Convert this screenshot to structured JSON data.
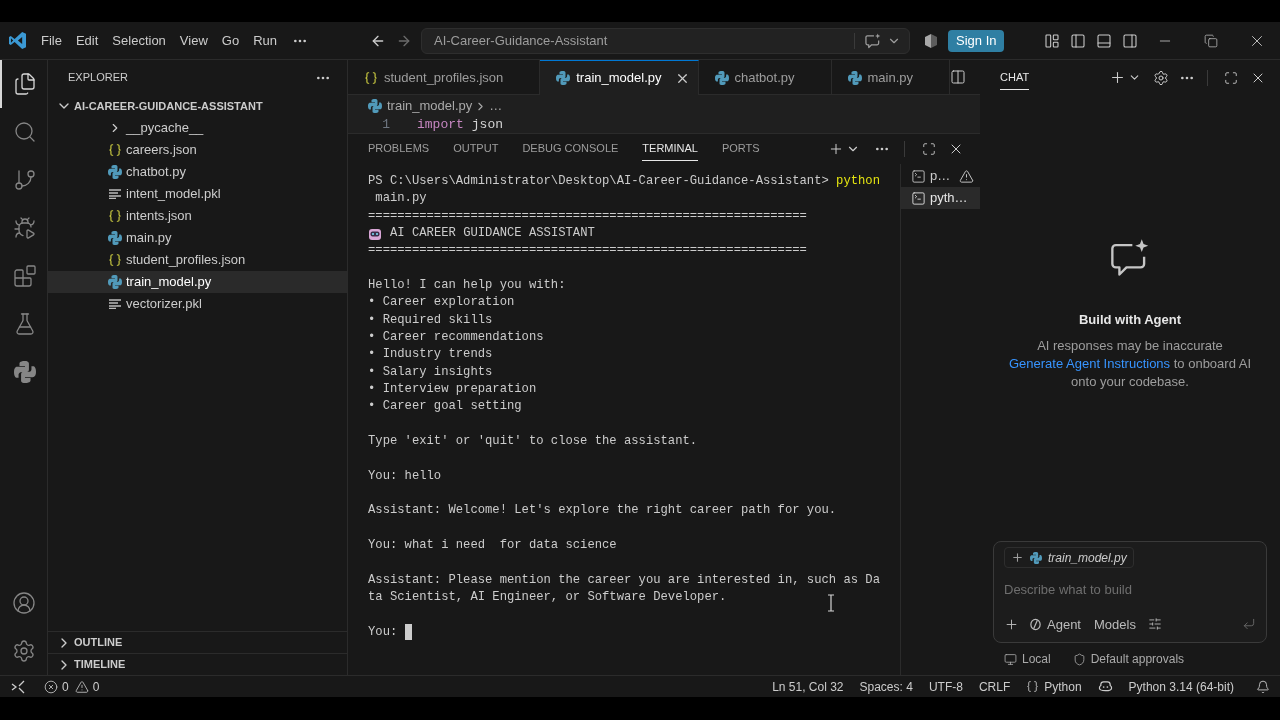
{
  "title_bar": {
    "menu": [
      "File",
      "Edit",
      "Selection",
      "View",
      "Go",
      "Run"
    ],
    "command_center": "AI-Career-Guidance-Assistant",
    "sign_in": "Sign In"
  },
  "activity_bar": {
    "items": [
      {
        "kind": "explorer",
        "selected": true
      },
      {
        "kind": "search",
        "selected": false
      },
      {
        "kind": "source_control",
        "selected": false
      },
      {
        "kind": "run_debug",
        "selected": false
      },
      {
        "kind": "extensions",
        "selected": false
      },
      {
        "kind": "testing",
        "selected": false
      },
      {
        "kind": "python",
        "selected": false
      }
    ]
  },
  "sidebar": {
    "title": "EXPLORER",
    "folder": {
      "name": "AI-CAREER-GUIDANCE-ASSISTANT",
      "expanded": true,
      "children": [
        {
          "name": "__pycache__",
          "kind": "folder",
          "expanded": false,
          "selected": false
        },
        {
          "name": "careers.json",
          "kind": "json",
          "selected": false
        },
        {
          "name": "chatbot.py",
          "kind": "python",
          "selected": false
        },
        {
          "name": "intent_model.pkl",
          "kind": "file",
          "selected": false
        },
        {
          "name": "intents.json",
          "kind": "json",
          "selected": false
        },
        {
          "name": "main.py",
          "kind": "python",
          "selected": false
        },
        {
          "name": "student_profiles.json",
          "kind": "json",
          "selected": false
        },
        {
          "name": "train_model.py",
          "kind": "python",
          "selected": true
        },
        {
          "name": "vectorizer.pkl",
          "kind": "file",
          "selected": false
        }
      ]
    },
    "sections": [
      {
        "name": "OUTLINE",
        "expanded": false
      },
      {
        "name": "TIMELINE",
        "expanded": false
      }
    ]
  },
  "editor": {
    "tabs": [
      {
        "label": "student_profiles.json",
        "kind": "json",
        "selected": false
      },
      {
        "label": "train_model.py",
        "kind": "python",
        "selected": true
      },
      {
        "label": "chatbot.py",
        "kind": "python",
        "selected": false
      },
      {
        "label": "main.py",
        "kind": "python",
        "selected": false
      }
    ],
    "breadcrumb": {
      "file": "train_model.py",
      "trail": "…"
    },
    "code": [
      {
        "number": "1",
        "tokens": [
          {
            "text": "import",
            "kind": "keyword"
          },
          {
            "text": "json",
            "kind": "plain"
          }
        ]
      }
    ]
  },
  "panel": {
    "tabs": [
      {
        "label": "PROBLEMS",
        "selected": false
      },
      {
        "label": "OUTPUT",
        "selected": false
      },
      {
        "label": "DEBUG CONSOLE",
        "selected": false
      },
      {
        "label": "TERMINAL",
        "selected": true
      },
      {
        "label": "PORTS",
        "selected": false
      }
    ],
    "terminal": {
      "lines": [
        {
          "kind": "command",
          "prompt": "PS C:\\Users\\Administrator\\Desktop\\AI-Career-Guidance-Assistant>",
          "command": "python"
        },
        {
          "kind": "output",
          "text": " main.py"
        },
        {
          "kind": "output",
          "text": "============================================================"
        },
        {
          "kind": "banner",
          "text": "AI CAREER GUIDANCE ASSISTANT"
        },
        {
          "kind": "output",
          "text": "============================================================"
        },
        {
          "kind": "blank"
        },
        {
          "kind": "output",
          "text": "Hello! I can help you with:"
        },
        {
          "kind": "output",
          "text": "• Career exploration"
        },
        {
          "kind": "output",
          "text": "• Required skills"
        },
        {
          "kind": "output",
          "text": "• Career recommendations"
        },
        {
          "kind": "output",
          "text": "• Industry trends"
        },
        {
          "kind": "output",
          "text": "• Salary insights"
        },
        {
          "kind": "output",
          "text": "• Interview preparation"
        },
        {
          "kind": "output",
          "text": "• Career goal setting"
        },
        {
          "kind": "blank"
        },
        {
          "kind": "output",
          "text": "Type 'exit' or 'quit' to close the assistant."
        },
        {
          "kind": "blank"
        },
        {
          "kind": "output",
          "text": "You: hello"
        },
        {
          "kind": "blank"
        },
        {
          "kind": "output",
          "text": "Assistant: Welcome! Let's explore the right career path for you."
        },
        {
          "kind": "blank"
        },
        {
          "kind": "output",
          "text": "You: what i need  for data science"
        },
        {
          "kind": "blank"
        },
        {
          "kind": "output",
          "text": "Assistant: Please mention the career you are interested in, such as Da"
        },
        {
          "kind": "output",
          "text": "ta Scientist, AI Engineer, or Software Developer."
        },
        {
          "kind": "blank"
        },
        {
          "kind": "input",
          "text": "You:"
        }
      ]
    },
    "sessions": [
      {
        "label": "p…",
        "selected": false,
        "warning": true
      },
      {
        "label": "pyth…",
        "selected": true,
        "warning": false
      }
    ]
  },
  "chat": {
    "tabs": [
      {
        "label": "CHAT",
        "selected": true
      }
    ],
    "heading": "Build with Agent",
    "note": "AI responses may be inaccurate",
    "link": "Generate Agent Instructions",
    "link_rest": "to onboard AI onto your codebase.",
    "input": {
      "attachment": "train_model.py",
      "placeholder": "Describe what to build",
      "mode": "Agent",
      "model": "Models"
    },
    "footer": [
      {
        "kind": "local",
        "label": "Local"
      },
      {
        "kind": "approvals",
        "label": "Default approvals"
      }
    ]
  },
  "status_bar": {
    "errors": "0",
    "warnings": "0",
    "items": [
      {
        "kind": "cursor",
        "text": "Ln 51, Col 32"
      },
      {
        "kind": "indent",
        "text": "Spaces: 4"
      },
      {
        "kind": "encoding",
        "text": "UTF-8"
      },
      {
        "kind": "eol",
        "text": "CRLF"
      },
      {
        "kind": "language",
        "text": "Python"
      },
      {
        "kind": "copilot"
      },
      {
        "kind": "interpreter",
        "text": "Python 3.14 (64-bit)"
      }
    ]
  }
}
